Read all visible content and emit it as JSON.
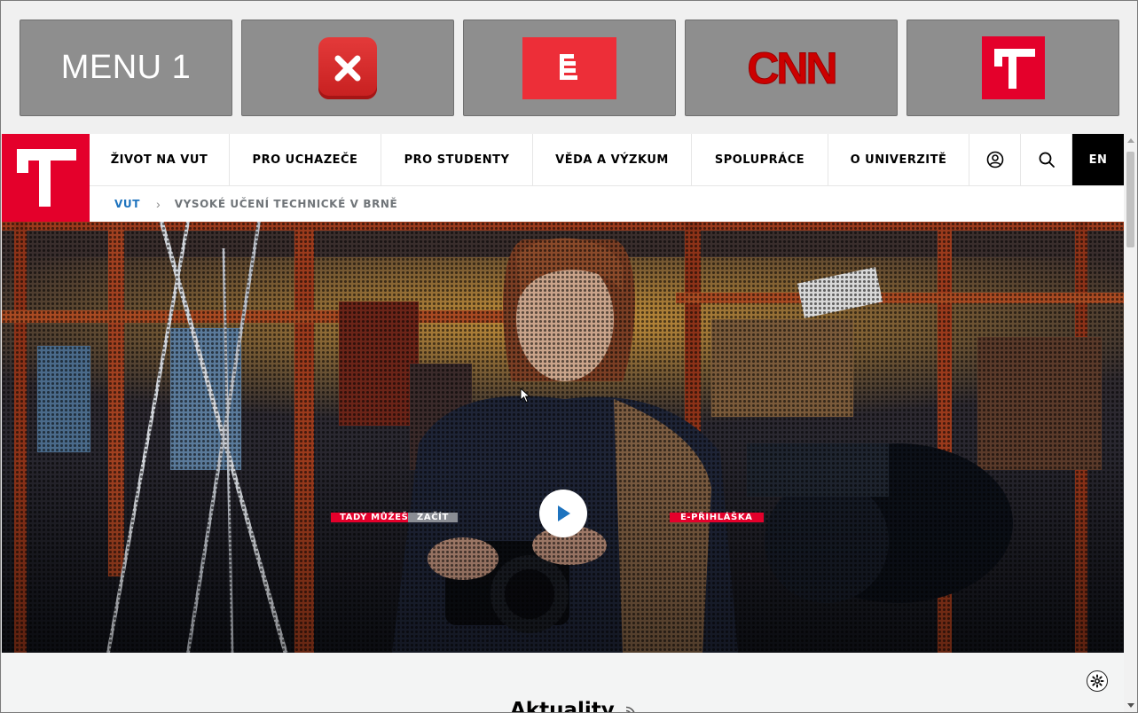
{
  "launcher": {
    "tiles": [
      {
        "label": "MENU 1",
        "icon": "text"
      },
      {
        "label": "",
        "icon": "x-logo-icon"
      },
      {
        "label": "",
        "icon": "ct24-logo-icon"
      },
      {
        "label": "CNN",
        "icon": "cnn-logo-icon"
      },
      {
        "label": "",
        "icon": "vut-logo-icon"
      }
    ]
  },
  "nav": {
    "items": [
      {
        "label": "ŽIVOT NA VUT"
      },
      {
        "label": "PRO UCHAZEČE"
      },
      {
        "label": "PRO STUDENTY"
      },
      {
        "label": "VĚDA A VÝZKUM"
      },
      {
        "label": "SPOLUPRÁCE"
      },
      {
        "label": "O UNIVERZITĚ"
      }
    ],
    "lang": "EN"
  },
  "breadcrumb": {
    "home": "VUT",
    "current": "VYSOKÉ UČENÍ TECHNICKÉ V BRNĚ"
  },
  "hero": {
    "tag_left_red": "TADY MŮŽEŠ",
    "tag_left_gray": "ZAČÍT",
    "tag_right": "E-PŘIHLÁŠKA"
  },
  "section": {
    "title": "Aktuality"
  },
  "colors": {
    "brand_red": "#e4002b",
    "link_blue": "#1e73be",
    "tile_gray": "#8e8e8e",
    "play_blue": "#1e73be"
  }
}
